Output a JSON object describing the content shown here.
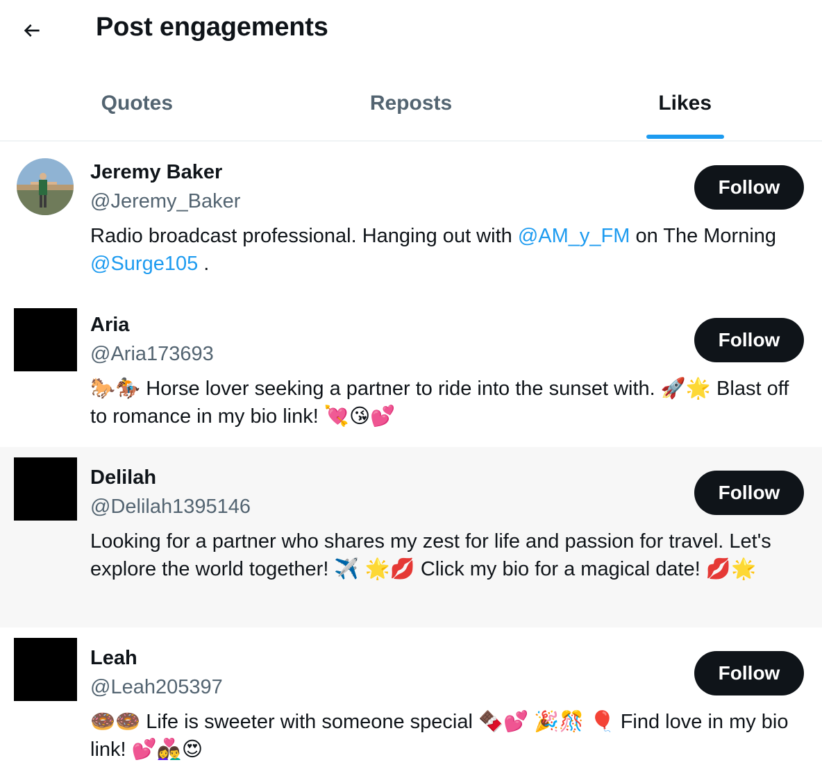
{
  "header": {
    "title": "Post engagements",
    "back_icon": "arrow-left-icon"
  },
  "tabs": [
    {
      "label": "Quotes",
      "active": false
    },
    {
      "label": "Reposts",
      "active": false
    },
    {
      "label": "Likes",
      "active": true
    }
  ],
  "colors": {
    "accent": "#1d9bf0",
    "text_primary": "#0f1419",
    "text_secondary": "#536471",
    "button_bg": "#0f1419",
    "hover_row_bg": "#f7f7f7"
  },
  "users": [
    {
      "name": "Jeremy Baker",
      "handle": "@Jeremy_Baker",
      "follow_label": "Follow",
      "bio_part1": "Radio broadcast professional. Hanging out with ",
      "bio_mention1": "@AM_y_FM",
      "bio_part2": " on The Morning ",
      "bio_mention2": "@Surge105",
      "bio_part3": " ."
    },
    {
      "name": "Aria",
      "handle": "@Aria173693",
      "follow_label": "Follow",
      "bio": "🐎🏇 Horse lover seeking a partner to ride into the sunset with. 🚀🌟 Blast off to romance in my bio link! 💘😘💕"
    },
    {
      "name": "Delilah",
      "handle": "@Delilah1395146",
      "follow_label": "Follow",
      "bio": "Looking for a partner who shares my zest for life and passion for travel. Let's explore the world together! ✈️ 🌟💋 Click my bio for a magical date! 💋🌟"
    },
    {
      "name": "Leah",
      "handle": "@Leah205397",
      "follow_label": "Follow",
      "bio": "🍩🍩 Life is sweeter with someone special 🍫💕 🎉🎊 🎈 Find love in my bio link! 💕👩‍❤️‍👨😍"
    }
  ]
}
